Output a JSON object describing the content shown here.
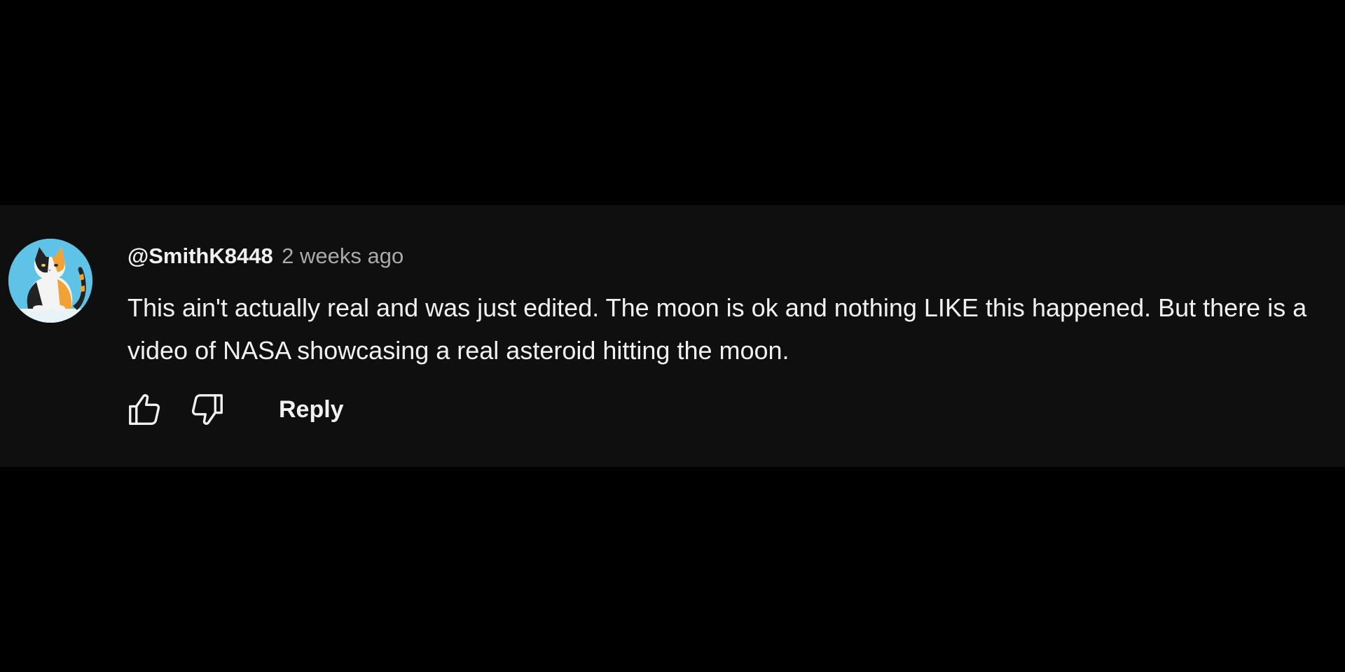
{
  "comment": {
    "author": "@SmithK8448",
    "timestamp": "2 weeks ago",
    "text": "This ain't actually real and was just edited. The moon is ok and nothing LIKE this happened. But there is a video of NASA showcasing a real asteroid hitting the moon.",
    "avatar_icon": "calico-cat-avatar"
  },
  "actions": {
    "like_icon": "thumbs-up-icon",
    "dislike_icon": "thumbs-down-icon",
    "reply_label": "Reply"
  },
  "colors": {
    "page_background": "#000000",
    "card_background": "#0f0f0f",
    "primary_text": "#f1f1f1",
    "secondary_text": "#aaaaaa",
    "avatar_background": "#5ec3e6"
  }
}
